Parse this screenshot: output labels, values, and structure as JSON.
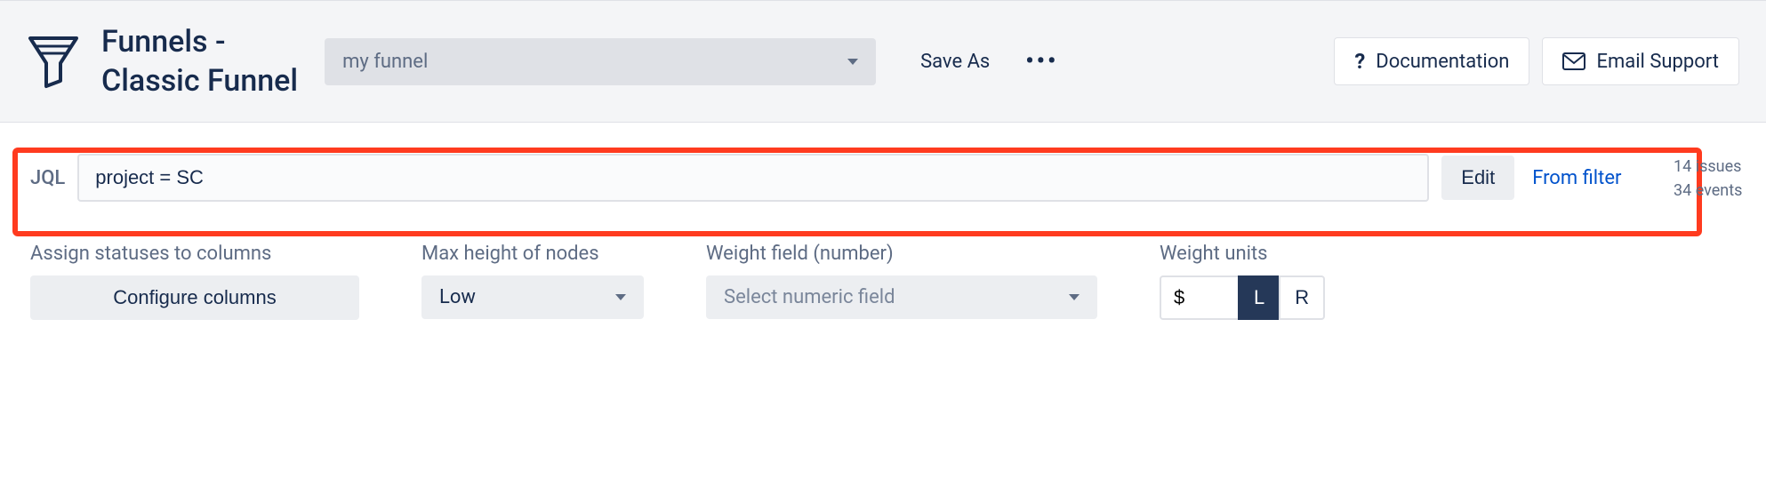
{
  "header": {
    "title_line1": "Funnels -",
    "title_line2": "Classic Funnel",
    "funnel_select": "my funnel",
    "save_as": "Save As",
    "documentation": "Documentation",
    "email_support": "Email Support"
  },
  "jql": {
    "label": "JQL",
    "value": "project = SC",
    "edit": "Edit",
    "from_filter": "From filter"
  },
  "stats": {
    "issues": "14 issues",
    "events": "34 events"
  },
  "controls": {
    "assign_label": "Assign statuses to columns",
    "configure_btn": "Configure columns",
    "max_height_label": "Max height of nodes",
    "max_height_value": "Low",
    "weight_field_label": "Weight field (number)",
    "weight_field_placeholder": "Select numeric field",
    "weight_units_label": "Weight units",
    "unit_symbol": "$",
    "toggle_left": "L",
    "toggle_right": "R"
  }
}
